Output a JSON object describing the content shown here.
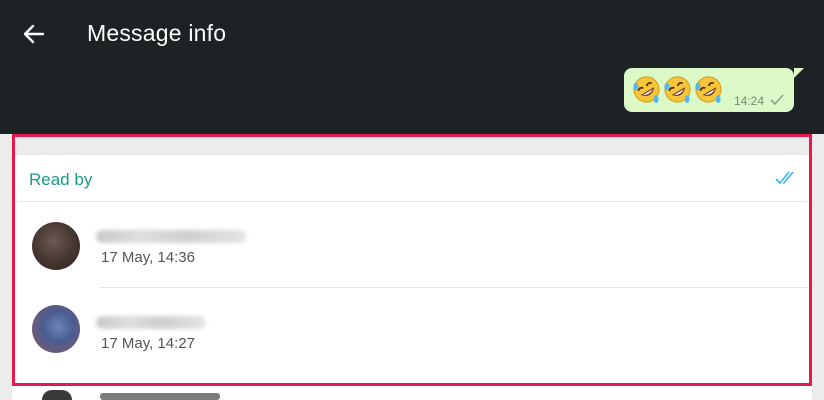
{
  "header": {
    "title": "Message info",
    "back_icon": "arrow-left-icon"
  },
  "message": {
    "emojis": [
      "rolling-on-floor-laughing",
      "rolling-on-floor-laughing",
      "rolling-on-floor-laughing"
    ],
    "time": "14:24",
    "status_icon": "single-check-icon",
    "bubble_color": "#dcf8c6"
  },
  "read_by": {
    "label": "Read by",
    "status_icon": "double-check-icon",
    "accent_color": "#1a9c85",
    "check_color": "#34b7f1",
    "entries": [
      {
        "time": "17 May, 14:36"
      },
      {
        "time": "17 May, 14:27"
      }
    ]
  },
  "highlight_color": "#e8174e"
}
